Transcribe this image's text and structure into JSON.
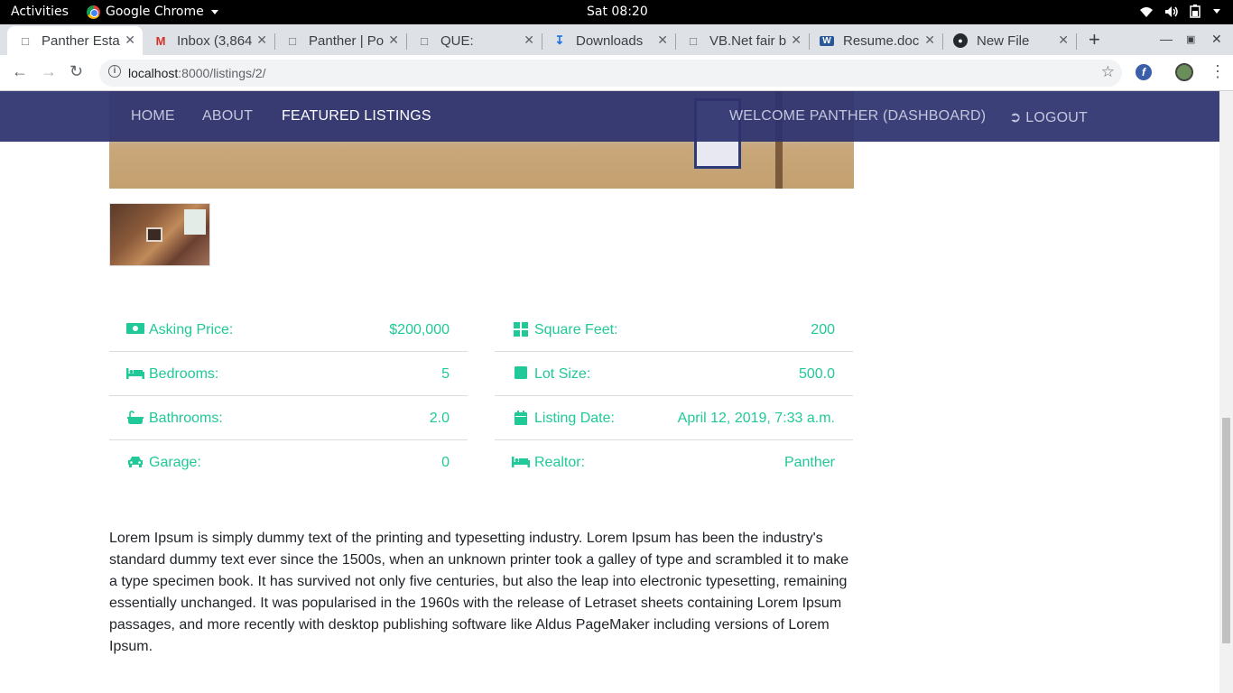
{
  "os_bar": {
    "activities": "Activities",
    "app_name": "Google Chrome",
    "clock": "Sat 08:20"
  },
  "tabs": [
    {
      "label": "Panther Esta",
      "icon": "page-icon"
    },
    {
      "label": "Inbox (3,864",
      "icon": "gmail-icon"
    },
    {
      "label": "Panther | Po",
      "icon": "page-icon"
    },
    {
      "label": "QUE:",
      "icon": "page-icon"
    },
    {
      "label": "Downloads",
      "icon": "download-icon"
    },
    {
      "label": "VB.Net fair b",
      "icon": "page-icon"
    },
    {
      "label": "Resume.doc",
      "icon": "word-icon"
    },
    {
      "label": "New File",
      "icon": "github-icon"
    }
  ],
  "address": {
    "host": "localhost",
    "path": ":8000/listings/2/"
  },
  "nav": {
    "home": "HOME",
    "about": "ABOUT",
    "featured": "FEATURED LISTINGS",
    "welcome": "WELCOME PANTHER (DASHBOARD)",
    "logout": "LOGOUT"
  },
  "facts_left": [
    {
      "label": "Asking Price:",
      "value": "$200,000",
      "icon": "money-icon"
    },
    {
      "label": "Bedrooms:",
      "value": "5",
      "icon": "bed-icon"
    },
    {
      "label": "Bathrooms:",
      "value": "2.0",
      "icon": "bath-icon"
    },
    {
      "label": "Garage:",
      "value": "0",
      "icon": "car-icon"
    }
  ],
  "facts_right": [
    {
      "label": "Square Feet:",
      "value": "200",
      "icon": "th-large-icon"
    },
    {
      "label": "Lot Size:",
      "value": "500.0",
      "icon": "square-icon"
    },
    {
      "label": "Listing Date:",
      "value": "April 12, 2019, 7:33 a.m.",
      "icon": "calendar-icon"
    },
    {
      "label": "Realtor:",
      "value": "Panther",
      "icon": "bed-icon"
    }
  ],
  "description": "Lorem Ipsum is simply dummy text of the printing and typesetting industry. Lorem Ipsum has been the industry's standard dummy text ever since the 1500s, when an unknown printer took a galley of type and scrambled it to make a type specimen book. It has survived not only five centuries, but also the leap into electronic typesetting, remaining essentially unchanged. It was popularised in the 1960s with the release of Letraset sheets containing Lorem Ipsum passages, and more recently with desktop publishing software like Aldus PageMaker including versions of Lorem Ipsum.",
  "colors": {
    "accent": "#20c997",
    "navbar": "#2d326e",
    "text": "#212529"
  }
}
